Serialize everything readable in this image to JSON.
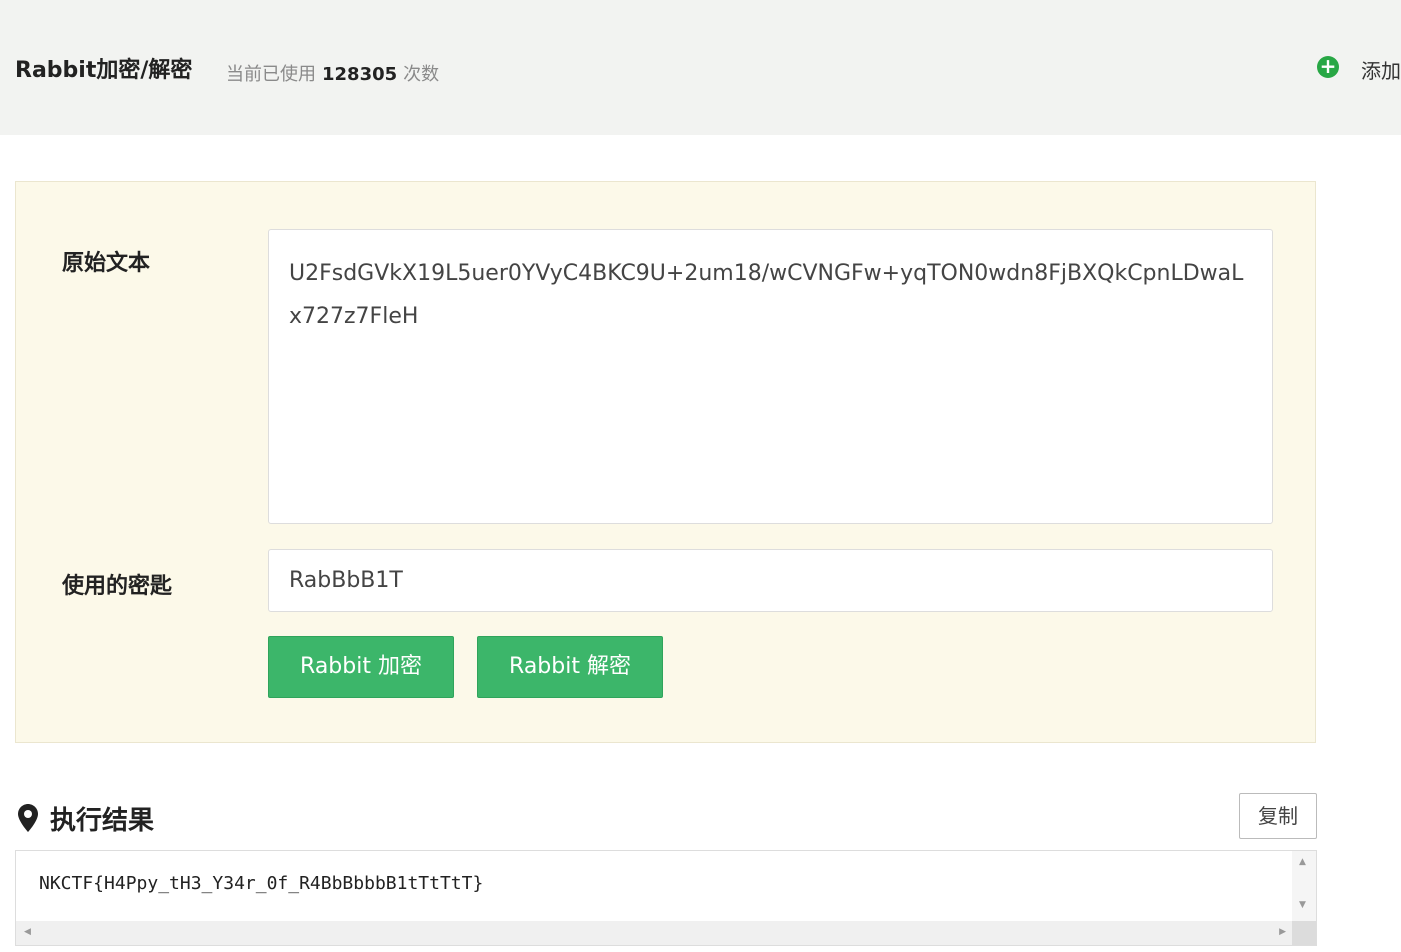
{
  "header": {
    "title": "Rabbit加密/解密",
    "usage_prefix": "当前已使用",
    "usage_count": "128305",
    "usage_suffix": "次数",
    "add_label": "添加",
    "add_icon": "plus-circle-icon"
  },
  "form": {
    "source_label": "原始文本",
    "source_text": "U2FsdGVkX19L5uer0YVyC4BKC9U+2um18/wCVNGFw+yqTON0wdn8FjBXQkCpnLDwaLx727z7FleH",
    "key_label": "使用的密匙",
    "key_value": "RabBbB1T",
    "encrypt_button": "Rabbit 加密",
    "decrypt_button": "Rabbit 解密"
  },
  "result": {
    "title": "执行结果",
    "title_icon": "map-pin-icon",
    "copy_button": "复制",
    "output": "NKCTF{H4Ppy_tH3_Y34r_0f_R4BbBbbbB1tTtTtT}"
  },
  "colors": {
    "header_bg": "#f2f3f1",
    "panel_bg": "#fcf9e9",
    "accent_green": "#3cb66a"
  }
}
